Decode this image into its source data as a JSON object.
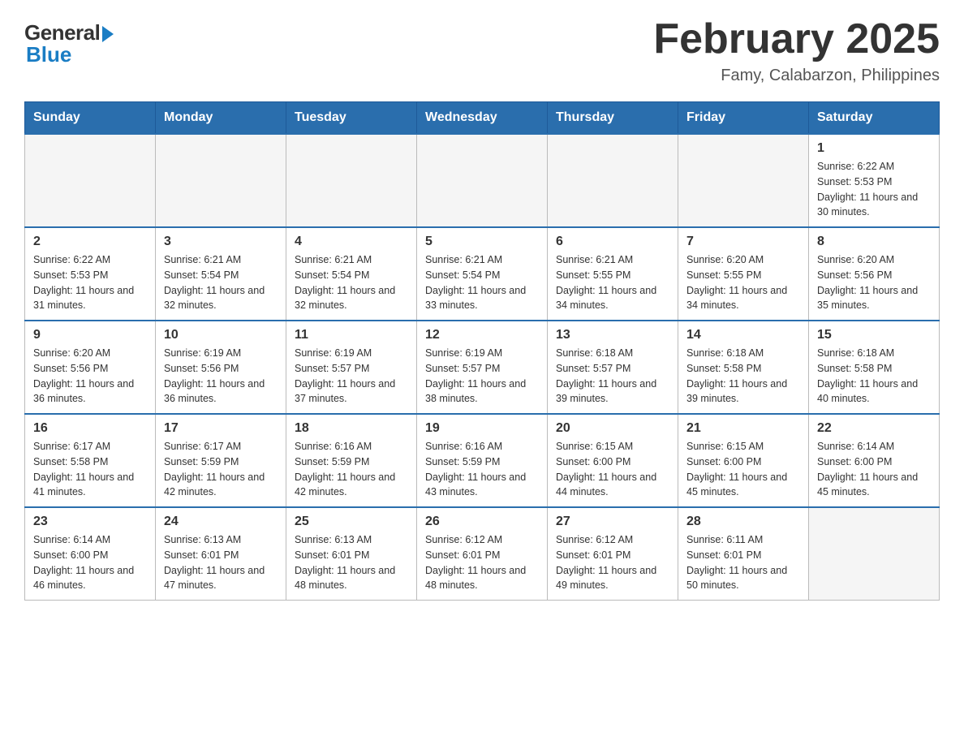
{
  "header": {
    "logo_general": "General",
    "logo_blue": "Blue",
    "main_title": "February 2025",
    "subtitle": "Famy, Calabarzon, Philippines"
  },
  "weekdays": [
    "Sunday",
    "Monday",
    "Tuesday",
    "Wednesday",
    "Thursday",
    "Friday",
    "Saturday"
  ],
  "weeks": [
    [
      {
        "day": "",
        "info": ""
      },
      {
        "day": "",
        "info": ""
      },
      {
        "day": "",
        "info": ""
      },
      {
        "day": "",
        "info": ""
      },
      {
        "day": "",
        "info": ""
      },
      {
        "day": "",
        "info": ""
      },
      {
        "day": "1",
        "info": "Sunrise: 6:22 AM\nSunset: 5:53 PM\nDaylight: 11 hours and 30 minutes."
      }
    ],
    [
      {
        "day": "2",
        "info": "Sunrise: 6:22 AM\nSunset: 5:53 PM\nDaylight: 11 hours and 31 minutes."
      },
      {
        "day": "3",
        "info": "Sunrise: 6:21 AM\nSunset: 5:54 PM\nDaylight: 11 hours and 32 minutes."
      },
      {
        "day": "4",
        "info": "Sunrise: 6:21 AM\nSunset: 5:54 PM\nDaylight: 11 hours and 32 minutes."
      },
      {
        "day": "5",
        "info": "Sunrise: 6:21 AM\nSunset: 5:54 PM\nDaylight: 11 hours and 33 minutes."
      },
      {
        "day": "6",
        "info": "Sunrise: 6:21 AM\nSunset: 5:55 PM\nDaylight: 11 hours and 34 minutes."
      },
      {
        "day": "7",
        "info": "Sunrise: 6:20 AM\nSunset: 5:55 PM\nDaylight: 11 hours and 34 minutes."
      },
      {
        "day": "8",
        "info": "Sunrise: 6:20 AM\nSunset: 5:56 PM\nDaylight: 11 hours and 35 minutes."
      }
    ],
    [
      {
        "day": "9",
        "info": "Sunrise: 6:20 AM\nSunset: 5:56 PM\nDaylight: 11 hours and 36 minutes."
      },
      {
        "day": "10",
        "info": "Sunrise: 6:19 AM\nSunset: 5:56 PM\nDaylight: 11 hours and 36 minutes."
      },
      {
        "day": "11",
        "info": "Sunrise: 6:19 AM\nSunset: 5:57 PM\nDaylight: 11 hours and 37 minutes."
      },
      {
        "day": "12",
        "info": "Sunrise: 6:19 AM\nSunset: 5:57 PM\nDaylight: 11 hours and 38 minutes."
      },
      {
        "day": "13",
        "info": "Sunrise: 6:18 AM\nSunset: 5:57 PM\nDaylight: 11 hours and 39 minutes."
      },
      {
        "day": "14",
        "info": "Sunrise: 6:18 AM\nSunset: 5:58 PM\nDaylight: 11 hours and 39 minutes."
      },
      {
        "day": "15",
        "info": "Sunrise: 6:18 AM\nSunset: 5:58 PM\nDaylight: 11 hours and 40 minutes."
      }
    ],
    [
      {
        "day": "16",
        "info": "Sunrise: 6:17 AM\nSunset: 5:58 PM\nDaylight: 11 hours and 41 minutes."
      },
      {
        "day": "17",
        "info": "Sunrise: 6:17 AM\nSunset: 5:59 PM\nDaylight: 11 hours and 42 minutes."
      },
      {
        "day": "18",
        "info": "Sunrise: 6:16 AM\nSunset: 5:59 PM\nDaylight: 11 hours and 42 minutes."
      },
      {
        "day": "19",
        "info": "Sunrise: 6:16 AM\nSunset: 5:59 PM\nDaylight: 11 hours and 43 minutes."
      },
      {
        "day": "20",
        "info": "Sunrise: 6:15 AM\nSunset: 6:00 PM\nDaylight: 11 hours and 44 minutes."
      },
      {
        "day": "21",
        "info": "Sunrise: 6:15 AM\nSunset: 6:00 PM\nDaylight: 11 hours and 45 minutes."
      },
      {
        "day": "22",
        "info": "Sunrise: 6:14 AM\nSunset: 6:00 PM\nDaylight: 11 hours and 45 minutes."
      }
    ],
    [
      {
        "day": "23",
        "info": "Sunrise: 6:14 AM\nSunset: 6:00 PM\nDaylight: 11 hours and 46 minutes."
      },
      {
        "day": "24",
        "info": "Sunrise: 6:13 AM\nSunset: 6:01 PM\nDaylight: 11 hours and 47 minutes."
      },
      {
        "day": "25",
        "info": "Sunrise: 6:13 AM\nSunset: 6:01 PM\nDaylight: 11 hours and 48 minutes."
      },
      {
        "day": "26",
        "info": "Sunrise: 6:12 AM\nSunset: 6:01 PM\nDaylight: 11 hours and 48 minutes."
      },
      {
        "day": "27",
        "info": "Sunrise: 6:12 AM\nSunset: 6:01 PM\nDaylight: 11 hours and 49 minutes."
      },
      {
        "day": "28",
        "info": "Sunrise: 6:11 AM\nSunset: 6:01 PM\nDaylight: 11 hours and 50 minutes."
      },
      {
        "day": "",
        "info": ""
      }
    ]
  ]
}
